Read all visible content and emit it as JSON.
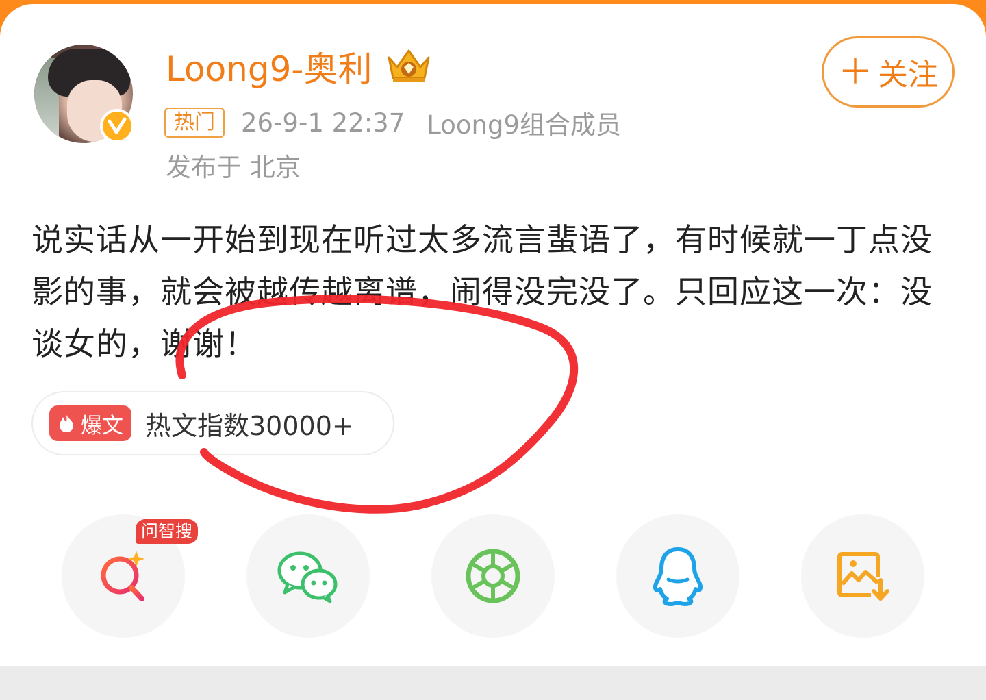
{
  "post": {
    "username": "Loong9-奥利",
    "follow_label": "关注",
    "hot_tag": "热门",
    "timestamp": "26-9-1 22:37",
    "source": "Loong9组合成员",
    "location": "发布于 北京",
    "body": "说实话从一开始到现在听过太多流言蜚语了，有时候就一丁点没影的事，就会被越传越离谱，闹得没完没了。只回应这一次：没谈女的，谢谢！",
    "hot_badge": "爆文",
    "hot_index": "热文指数30000+"
  },
  "share": {
    "ai_search_badge": "问智搜",
    "buttons": [
      {
        "icon": "ai-search-icon",
        "color": "#ec3d5c"
      },
      {
        "icon": "wechat-icon",
        "color": "#3cc06b"
      },
      {
        "icon": "moments-icon",
        "color": "#6ac25a"
      },
      {
        "icon": "qq-icon",
        "color": "#1fa3e8"
      },
      {
        "icon": "save-image-icon",
        "color": "#f5a623"
      }
    ]
  },
  "colors": {
    "accent": "#f07d18",
    "annotation": "#f0262a"
  }
}
